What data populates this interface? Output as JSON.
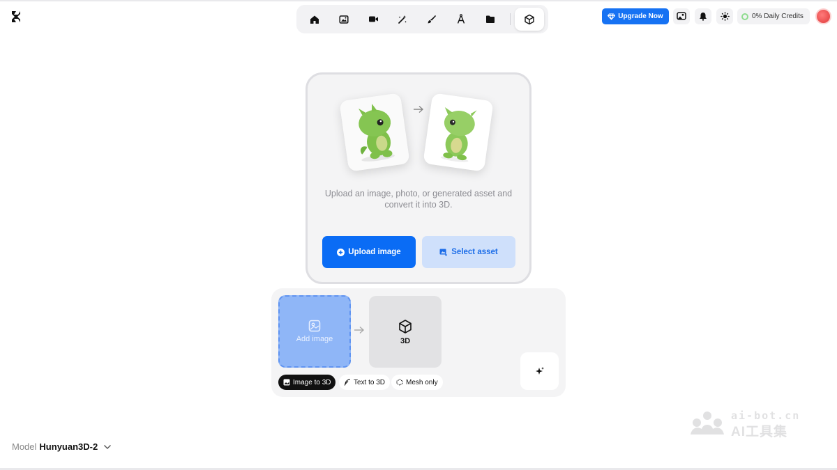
{
  "toolbar": {
    "items": [
      {
        "icon": "home-icon"
      },
      {
        "icon": "image-icon"
      },
      {
        "icon": "video-icon"
      },
      {
        "icon": "magic-wand-icon"
      },
      {
        "icon": "brush-icon"
      },
      {
        "icon": "vector-pen-icon"
      },
      {
        "icon": "folder-icon"
      },
      {
        "icon": "cube-icon",
        "active": true
      }
    ]
  },
  "header": {
    "upgrade_label": "Upgrade Now",
    "credits_label": "0% Daily Credits"
  },
  "upload": {
    "description": "Upload an image, photo, or generated asset and convert it into 3D.",
    "upload_button": "Upload image",
    "select_button": "Select asset"
  },
  "workflow": {
    "add_image_label": "Add image",
    "output_label": "3D",
    "modes": [
      {
        "label": "Image to 3D",
        "active": true
      },
      {
        "label": "Text to 3D",
        "active": false
      },
      {
        "label": "Mesh only",
        "active": false
      }
    ]
  },
  "model": {
    "label": "Model",
    "name": "Hunyuan3D-2"
  },
  "watermark": {
    "domain": "ai-bot.cn",
    "text": "AI工具集"
  },
  "colors": {
    "primary": "#0a6cf5",
    "primary_light": "#cfe0fb",
    "add_image_bg": "#8fb6f7",
    "dragon_green": "#7fc04a"
  }
}
